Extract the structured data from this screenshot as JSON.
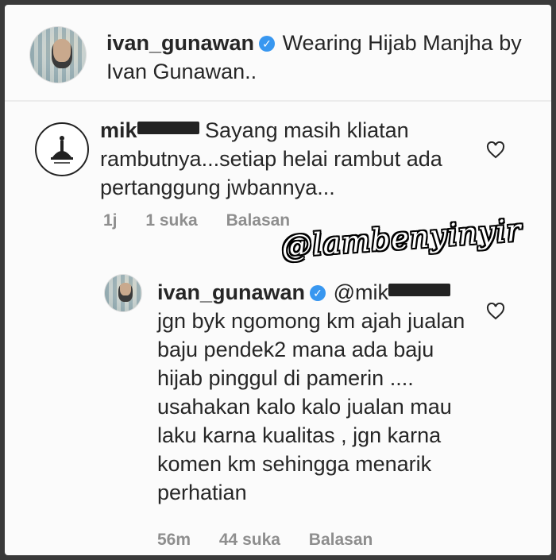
{
  "caption": {
    "username": "ivan_gunawan",
    "text": "Wearing Hijab Manjha by Ivan Gunawan.."
  },
  "comment": {
    "username_prefix": "mik",
    "text": "Sayang masih kliatan rambutnya...setiap helai rambut ada pertanggung jwbannya...",
    "time": "1j",
    "likes": "1 suka",
    "reply_label": "Balasan"
  },
  "reply": {
    "username": "ivan_gunawan",
    "mention_prefix": "@mik",
    "text": "jgn byk ngomong km ajah jualan baju  pendek2 mana ada baju hijab pinggul di pamerin .... usahakan kalo kalo jualan mau laku karna kualitas , jgn karna komen km sehingga menarik perhatian",
    "time": "56m",
    "likes": "44 suka",
    "reply_label": "Balasan"
  },
  "watermark": "@lambenyinyir",
  "colors": {
    "verified": "#3897f0",
    "text": "#262626",
    "muted": "#8e8e8e"
  },
  "icons": [
    "verified-icon",
    "heart-icon"
  ]
}
